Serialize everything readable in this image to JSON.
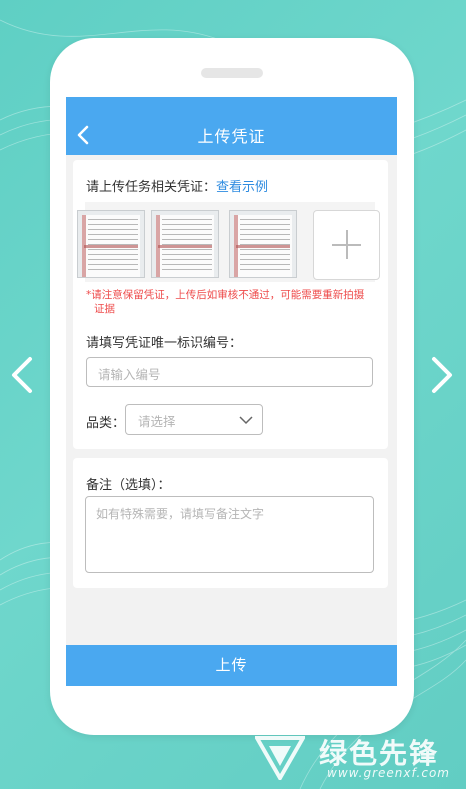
{
  "header": {
    "title": "上传凭证"
  },
  "proof_section": {
    "prompt": "请上传任务相关凭证：",
    "example_link": "查看示例",
    "warning_line1": "*请注意保留凭证，上传后如审核不通过，可能需要重新拍摄",
    "warning_line2": "证据"
  },
  "id_field": {
    "label": "请填写凭证唯一标识编号：",
    "placeholder": "请输入编号"
  },
  "category": {
    "label": "品类：",
    "placeholder": "请选择"
  },
  "note": {
    "label": "备注（选填）：",
    "placeholder": "如有特殊需要，请填写备注文字"
  },
  "footer": {
    "upload_label": "上传"
  },
  "watermark": {
    "title": "绿色先锋",
    "url": "www.greenxf.com"
  },
  "colors": {
    "accent": "#4aa8f0",
    "warning": "#ee4b4b",
    "link": "#2f8ce0",
    "background": "#62cdc3"
  }
}
